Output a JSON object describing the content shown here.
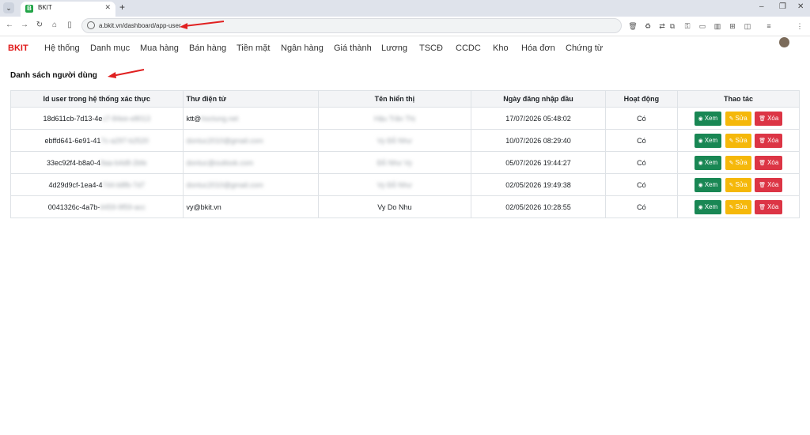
{
  "browser": {
    "tab_title": "BKIT",
    "tab_favicon": "B",
    "url": "a.bkit.vn/dashboard/app-user"
  },
  "nav": {
    "brand": "BKIT",
    "items": [
      "Hệ thống",
      "Danh mục",
      "Mua hàng",
      "Bán hàng",
      "Tiền mặt",
      "Ngân hàng",
      "Giá thành",
      "Lương",
      "TSCĐ",
      "CCDC",
      "Kho",
      "Hóa đơn",
      "Chứng từ"
    ]
  },
  "page": {
    "title": "Danh sách người dùng"
  },
  "table": {
    "headers": [
      "Id user trong hệ thống xác thực",
      "Thư điện tử",
      "Tên hiển thị",
      "Ngày đăng nhập đầu",
      "Hoạt động",
      "Thao tác"
    ],
    "rows": [
      {
        "id": "18d611cb-7d13-4e",
        "id_hidden": "c7-84ee-e8013",
        "email": "ktt@",
        "email_hidden": "hoctung.net",
        "name": "",
        "name_hidden": "Hậu Trần Thị",
        "date": "17/07/2026 05:48:02",
        "active": "Có"
      },
      {
        "id": "ebffd641-6e91-41",
        "id_hidden": "7c-a297-b2520",
        "email": "",
        "email_hidden": "dontuc2010@gmail.com",
        "name": "",
        "name_hidden": "Vy Đỗ Như",
        "date": "10/07/2026 08:29:40",
        "active": "Có"
      },
      {
        "id": "33ec92f4-b8a0-4",
        "id_hidden": "9aa-b4d8-2bfe",
        "email": "",
        "email_hidden": "dontuc@outlook.com",
        "name": "",
        "name_hidden": "Đỗ Như Vy",
        "date": "05/07/2026 19:44:27",
        "active": "Có"
      },
      {
        "id": "4d29d9cf-1ea4-4",
        "id_hidden": "744-b8fb-7d7",
        "email": "",
        "email_hidden": "dontuc2010@gmail.com",
        "name": "",
        "name_hidden": "Vy Đỗ Như",
        "date": "02/05/2026 19:49:38",
        "active": "Có"
      },
      {
        "id": "0041326c-4a7b-",
        "id_hidden": "4459-9f59-acc",
        "email": "vy@bkit.vn",
        "email_hidden": "",
        "name": "Vy Do Nhu",
        "name_hidden": "",
        "date": "02/05/2026 10:28:55",
        "active": "Có"
      }
    ],
    "action_labels": {
      "view": "Xem",
      "edit": "Sửa",
      "delete": "Xóa"
    }
  },
  "colors": {
    "brand": "#e01a1a",
    "view": "#198754",
    "edit": "#f5b80a",
    "delete": "#dc3545",
    "arrow": "#e02020"
  },
  "icons": [
    "menu-icon",
    "favicon-icon",
    "close-icon",
    "plus-icon",
    "back-icon",
    "forward-icon",
    "reload-icon",
    "home-icon",
    "sidebar-icon",
    "site-info-icon",
    "eye-icon",
    "pencil-icon",
    "trash-icon"
  ]
}
